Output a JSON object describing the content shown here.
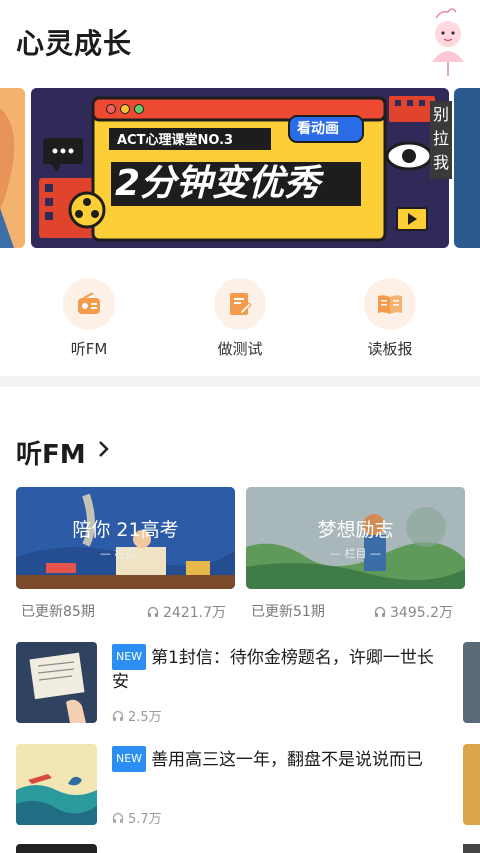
{
  "header": {
    "title": "心灵成长",
    "mascot_icon": "cartoon-mascot-icon"
  },
  "banner": {
    "course_label": "ACT心理课堂NO.3",
    "tag": "看动画",
    "headline": "2分钟变优秀",
    "side_text": [
      "别",
      "拉",
      "我"
    ]
  },
  "quick_links": [
    {
      "label": "听FM",
      "icon": "radio-icon"
    },
    {
      "label": "做测试",
      "icon": "test-edit-icon"
    },
    {
      "label": "读板报",
      "icon": "open-book-icon"
    }
  ],
  "fm_section": {
    "title": "听FM",
    "cards": [
      {
        "title": "陪你 21高考",
        "subtitle": "— 栏目 —",
        "updated": "已更新85期",
        "plays": "2421.7万"
      },
      {
        "title": "梦想励志",
        "subtitle": "— 栏目 —",
        "updated": "已更新51期",
        "plays": "3495.2万"
      }
    ],
    "items": [
      {
        "badge": "NEW",
        "title": "第1封信：待你金榜题名，许卿一世长安",
        "plays": "2.5万"
      },
      {
        "badge": "NEW",
        "title": "善用高三这一年，翻盘不是说说而已",
        "plays": "5.7万"
      }
    ]
  },
  "colors": {
    "accent": "#f49b4c",
    "badge_blue": "#2b8ef3",
    "banner_yellow": "#f8c531",
    "banner_bg": "#2f2a57"
  }
}
